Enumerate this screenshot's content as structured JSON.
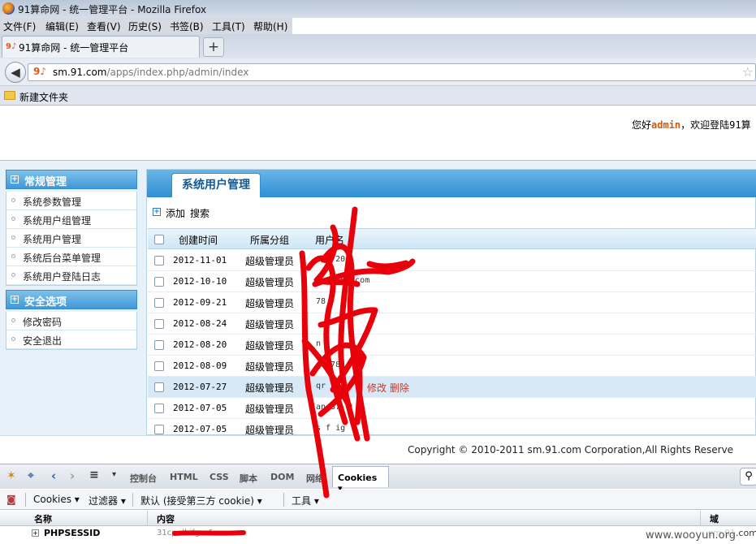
{
  "window": {
    "title": "91算命网 - 统一管理平台 - Mozilla Firefox"
  },
  "menu": [
    "文件(F)",
    "编辑(E)",
    "查看(V)",
    "历史(S)",
    "书签(B)",
    "工具(T)",
    "帮助(H)"
  ],
  "tab": {
    "label": "91算命网 - 统一管理平台",
    "new_tab": "+"
  },
  "urlbar": {
    "host": "sm.91.com",
    "path": "/apps/index.php/admin/index"
  },
  "bookmarks": {
    "folder_label": "新建文件夹"
  },
  "header": {
    "greeting": "您好",
    "user": "admin",
    "welcome": "，欢迎登陆91算"
  },
  "sidebar": {
    "section1": {
      "title": "常规管理",
      "items": [
        "系统参数管理",
        "系统用户组管理",
        "系统用户管理",
        "系统后台菜单管理",
        "系统用户登陆日志"
      ]
    },
    "section2": {
      "title": "安全选项",
      "items": [
        "修改密码",
        "安全退出"
      ]
    }
  },
  "main": {
    "tab": "系统用户管理",
    "actions": {
      "add": "添加",
      "search": "搜索"
    },
    "columns": {
      "created": "创建时间",
      "group": "所属分组",
      "username": "用户名"
    },
    "rows": [
      {
        "date": "2012-11-01",
        "group": "超级管理员",
        "name": "tq    720",
        "action": ""
      },
      {
        "date": "2012-10-10",
        "group": "超级管理员",
        "name": "li           @163.com",
        "action": ""
      },
      {
        "date": "2012-09-21",
        "group": "超级管理员",
        "name": "      78",
        "action": ""
      },
      {
        "date": "2012-08-24",
        "group": "超级管理员",
        "name": "",
        "action": ""
      },
      {
        "date": "2012-08-20",
        "group": "超级管理员",
        "name": "  n",
        "action": ""
      },
      {
        "date": "2012-08-09",
        "group": "超级管理员",
        "name": "  qu   78",
        "action": ""
      },
      {
        "date": "2012-07-27",
        "group": "超级管理员",
        "name": "  qr     19",
        "action": "修改 删除"
      },
      {
        "date": "2012-07-05",
        "group": "超级管理员",
        "name": "  an    87",
        "action": ""
      },
      {
        "date": "2012-07-05",
        "group": "超级管理员",
        "name": "  s f   ig",
        "action": ""
      }
    ]
  },
  "footer": {
    "copyright": "Copyright © 2010-2011 sm.91.com Corporation,All Rights Reserve"
  },
  "firebug": {
    "tabs": [
      "控制台",
      "HTML",
      "CSS",
      "脚本",
      "DOM",
      "网络"
    ],
    "selected_tab": "Cookies ▾",
    "subbar": {
      "cookies": "Cookies ▾",
      "filter": "过滤器 ▾",
      "default": "默认 (接受第三方 cookie) ▾",
      "tools": "工具 ▾"
    },
    "columns": {
      "name": "名称",
      "content": "内容",
      "domain": "域"
    },
    "cookie": {
      "name": "PHPSESSID",
      "value": "31cp                            dhifgm6",
      "domain": "sm.91.com"
    }
  },
  "watermark": "www.wooyun.org",
  "colors": {
    "accent": "#2f8fd3",
    "scribble": "#e8000b",
    "admin": "#d05a0a"
  }
}
